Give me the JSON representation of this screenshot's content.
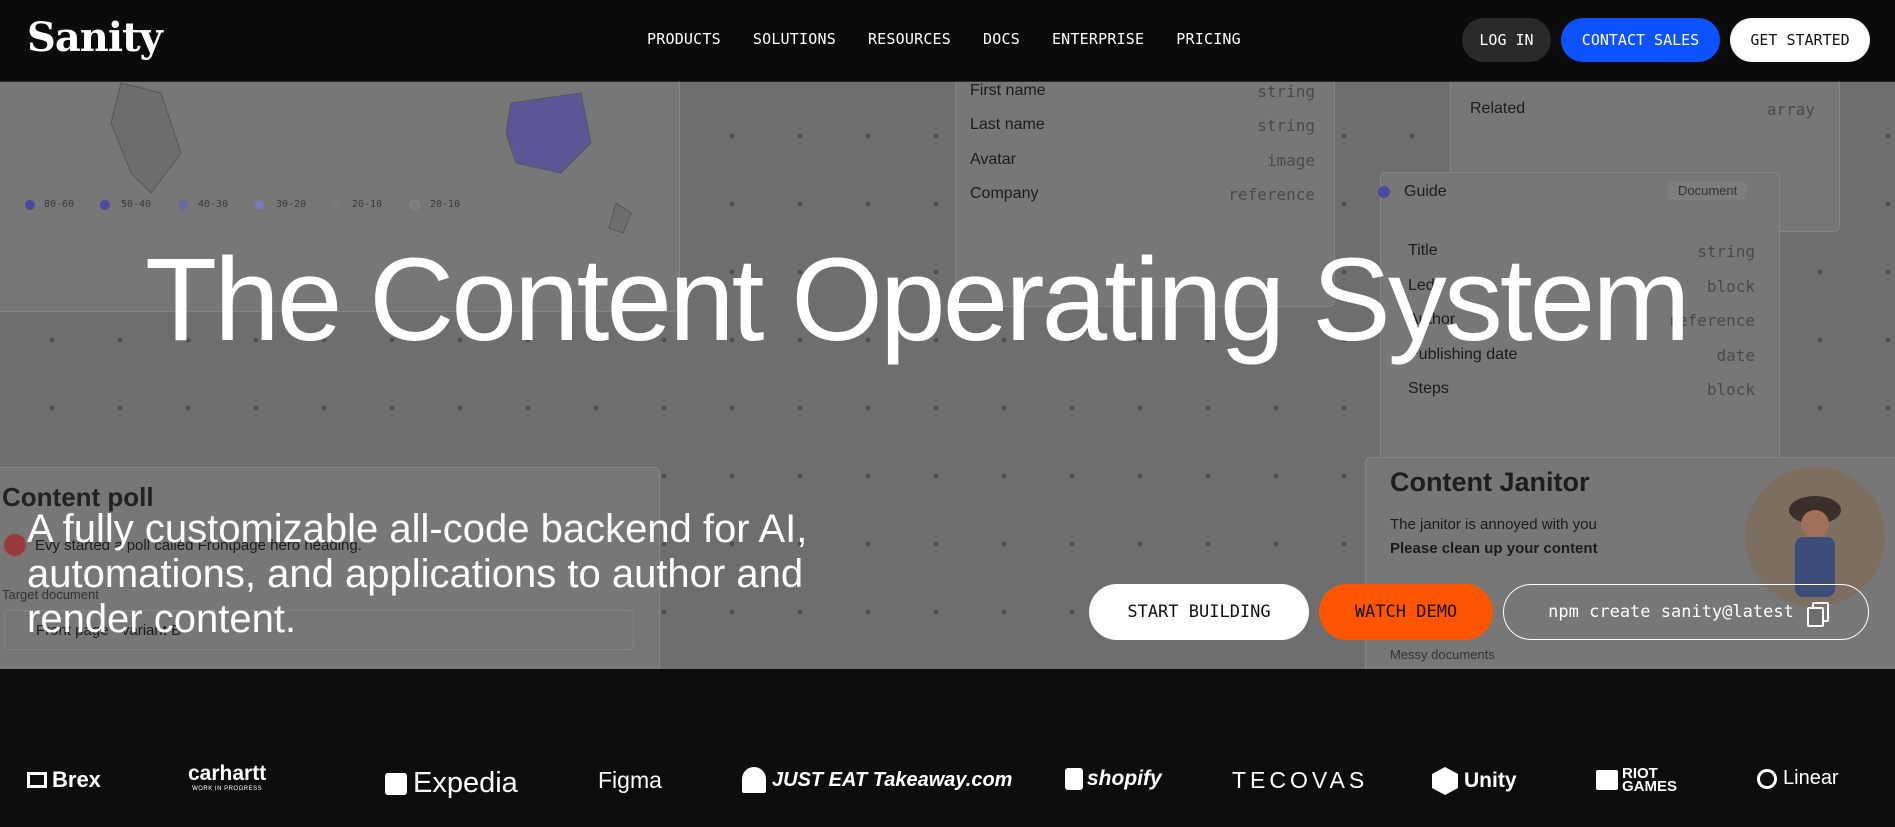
{
  "nav": {
    "logo": "Sanity",
    "menu": [
      "PRODUCTS",
      "SOLUTIONS",
      "RESOURCES",
      "DOCS",
      "ENTERPRISE",
      "PRICING"
    ],
    "login": "LOG IN",
    "contact": "CONTACT SALES",
    "get_started": "GET STARTED"
  },
  "background": {
    "legend": [
      "80-60",
      "50-40",
      "40-30",
      "30-20",
      "20-10",
      "20-10"
    ],
    "schema_fields": [
      {
        "name": "First name",
        "type": "string"
      },
      {
        "name": "Last name",
        "type": "string"
      },
      {
        "name": "Avatar",
        "type": "image"
      },
      {
        "name": "Company",
        "type": "reference"
      }
    ],
    "related": {
      "name": "Related",
      "type": "array"
    },
    "guide": {
      "title": "Guide",
      "badge": "Document"
    },
    "guide_fields": [
      {
        "name": "Title",
        "type": "string"
      },
      {
        "name": "Lede",
        "type": "block"
      },
      {
        "name": "Author",
        "type": "reference"
      },
      {
        "name": "Publishing date",
        "type": "date"
      },
      {
        "name": "Steps",
        "type": "block"
      }
    ],
    "poll": {
      "title": "Content poll",
      "activity": "Evy started a poll called Frontpage hero heading.",
      "target_label": "Target document",
      "target_value": "Front page - variant B"
    },
    "janitor": {
      "title": "Content Janitor",
      "line1": "The janitor is annoyed with you",
      "line2": "Please clean up your content",
      "footer": "Messy documents"
    }
  },
  "hero": {
    "title": "The Content Operating System",
    "subtitle": "A fully customizable all-code backend for AI, automations, and applications to author and render content.",
    "start_building": "START BUILDING",
    "watch_demo": "WATCH DEMO",
    "npm_command": "npm create sanity@latest"
  },
  "logos": [
    "Brex",
    "carhartt",
    "Expedia",
    "Figma",
    "JUST EAT Takeaway.com",
    "shopify",
    "TECOVAS",
    "Unity",
    "RIOT GAMES",
    "Linear"
  ],
  "logos_tagline": "WORK IN PROGRESS",
  "colors": {
    "nav_bg": "#0b0b0b",
    "contact_blue": "#0d52ff",
    "demo_orange": "#ff5500",
    "hero_bg": "#6e6e6e"
  }
}
